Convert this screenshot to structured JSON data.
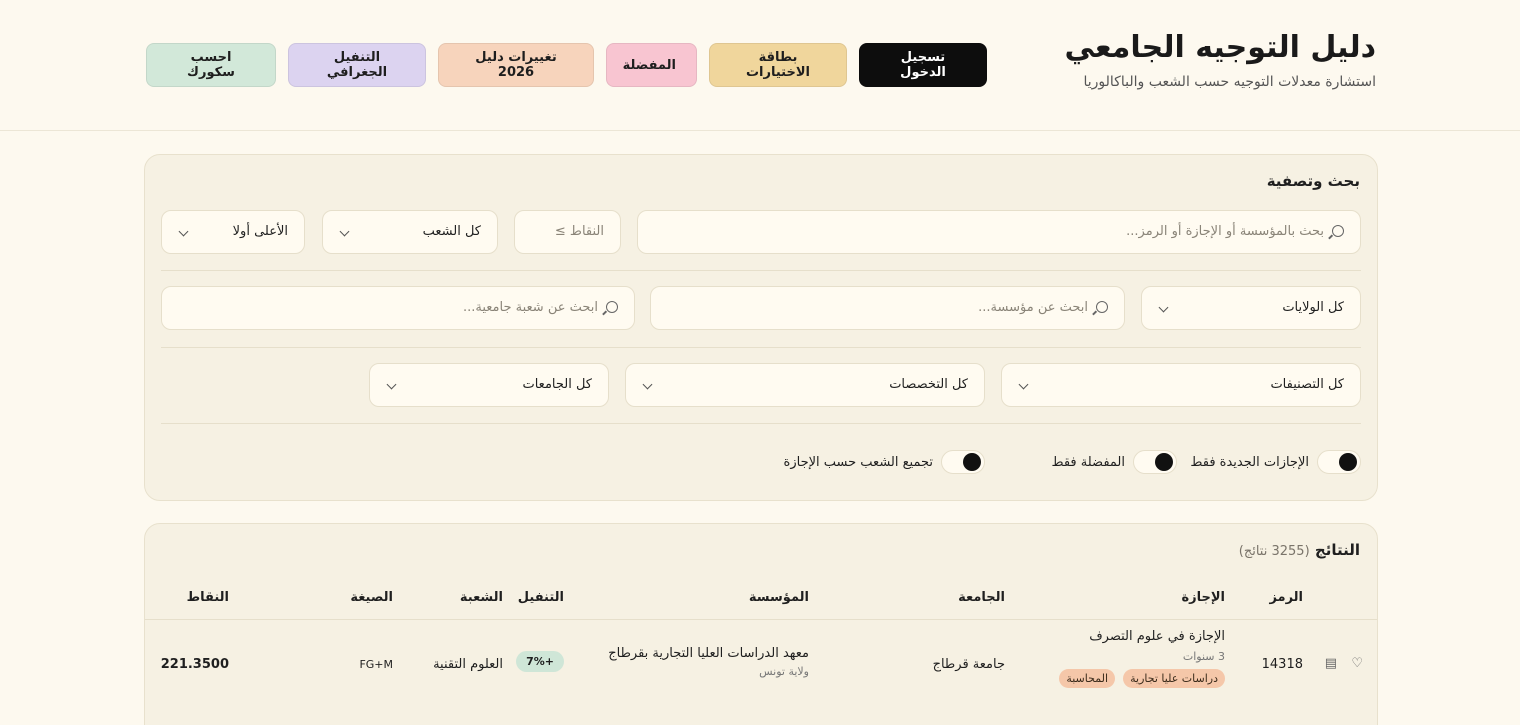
{
  "header": {
    "title": "دليل التوجيه الجامعي",
    "subtitle": "استشارة معدلات التوجيه حسب الشعب والباكالوريا",
    "nav": {
      "calc": "احسب سكورك",
      "geo": "التنفيل الجغرافي",
      "changes": "تغييرات دليل 2026",
      "favorites": "المفضلة",
      "choices": "بطاقة الاختيارات",
      "login": "تسجيل الدخول"
    }
  },
  "search": {
    "title": "بحث وتصفية",
    "query_placeholder": "بحث بالمؤسسة أو الإجازة أو الرمز...",
    "points_placeholder": "النقاط ≥",
    "branch_select": "كل الشعب",
    "sort_select": "الأعلى أولا",
    "wilaya_select": "كل الولايات",
    "institution_placeholder": "ابحث عن مؤسسة...",
    "uni_branch_placeholder": "ابحث عن شعبة جامعية...",
    "category_select": "كل التصنيفات",
    "specialty_select": "كل التخصصات",
    "university_select": "كل الجامعات",
    "toggles": {
      "new_only": "الإجازات الجديدة فقط",
      "favorites_only": "المفضلة فقط",
      "group_by": "تجميع الشعب حسب الإجازة"
    }
  },
  "results": {
    "title": "النتائج",
    "count": "(3255 نتائج)",
    "columns": {
      "code": "الرمز",
      "degree": "الإجازة",
      "university": "الجامعة",
      "institution": "المؤسسة",
      "bonus": "التنفيل",
      "branch": "الشعبة",
      "formula": "الصيغة",
      "points": "النقاط"
    },
    "rows": [
      {
        "code": "14318",
        "degree": "الإجازة في علوم التصرف",
        "duration": "3 سنوات",
        "tags": [
          "دراسات عليا تجارية",
          "المحاسبة"
        ],
        "university": "جامعة قرطاج",
        "institution": "معهد الدراسات العليا التجارية بقرطاج",
        "wilaya": "ولاية تونس",
        "bonus": "+7%",
        "branch": "العلوم التقنية",
        "formula": "FG+M",
        "points": "221.3500"
      }
    ]
  }
}
